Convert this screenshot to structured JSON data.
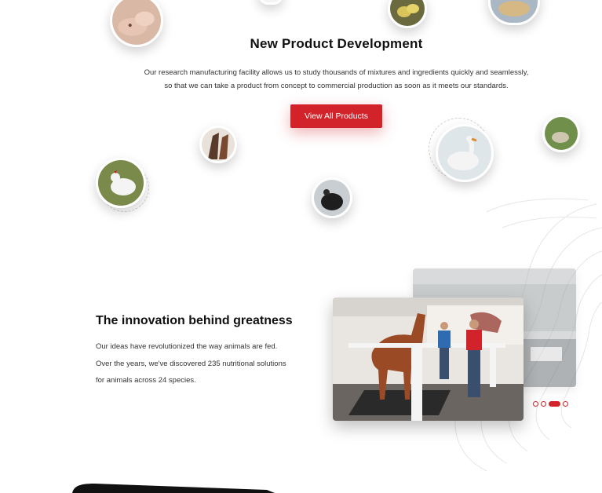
{
  "product_dev": {
    "title": "New Product Development",
    "description_line1": "Our research manufacturing facility allows us to study thousands of mixtures and ingredients quickly and seamlessly,",
    "description_line2": "so that we can take a product from concept to commercial production as soon as it meets our standards.",
    "button_label": "View All Products"
  },
  "animal_bubbles": [
    "pigs-icon",
    "ducklings-icon",
    "chicks-icon",
    "horses-icon",
    "goose-icon",
    "sheep-icon",
    "chicken-icon",
    "turkey-icon"
  ],
  "innovation": {
    "title": "The innovation behind greatness",
    "line1": "Our ideas have revolutionized the way animals are fed.",
    "line2": "Over the years, we've discovered 235 nutritional solutions",
    "line3": "for animals across 24 species."
  },
  "carousel": {
    "slide_count": 4,
    "active_index": 2
  },
  "colors": {
    "accent": "#d2232a",
    "text": "#1a1a1a"
  }
}
